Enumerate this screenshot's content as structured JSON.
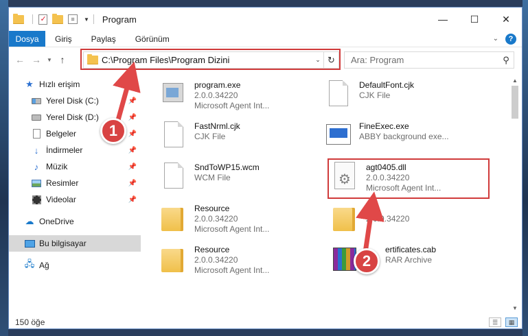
{
  "window": {
    "title": "Program",
    "controls": {
      "minimize": "—",
      "maximize": "☐",
      "close": "✕"
    }
  },
  "ribbon": {
    "tabs": [
      "Dosya",
      "Giriş",
      "Paylaş",
      "Görünüm"
    ],
    "help": "?"
  },
  "address_bar": {
    "path": "C:\\Program Files\\Program Dizini"
  },
  "search": {
    "placeholder": "Ara: Program"
  },
  "sidebar": {
    "items": [
      {
        "label": "Hızlı erişim",
        "icon": "star-icon",
        "pinned": false
      },
      {
        "label": "Yerel Disk (C:)",
        "icon": "drive-c-icon",
        "pinned": true
      },
      {
        "label": "Yerel Disk (D:)",
        "icon": "drive-icon",
        "pinned": true
      },
      {
        "label": "Belgeler",
        "icon": "document-icon",
        "pinned": true
      },
      {
        "label": "İndirmeler",
        "icon": "download-icon",
        "pinned": true
      },
      {
        "label": "Müzik",
        "icon": "music-icon",
        "pinned": true
      },
      {
        "label": "Resimler",
        "icon": "pictures-icon",
        "pinned": true
      },
      {
        "label": "Videolar",
        "icon": "videos-icon",
        "pinned": true
      },
      {
        "label": "OneDrive",
        "icon": "cloud-icon",
        "pinned": false
      },
      {
        "label": "Bu bilgisayar",
        "icon": "computer-icon",
        "pinned": false,
        "selected": true
      },
      {
        "label": "Ağ",
        "icon": "network-icon",
        "pinned": false
      }
    ]
  },
  "files": [
    {
      "name": "program.exe",
      "line2": "2.0.0.34220",
      "line3": "Microsoft Agent Int...",
      "icon": "exe-icon"
    },
    {
      "name": "DefaultFont.cjk",
      "line2": "CJK File",
      "line3": "",
      "icon": "blank-file-icon"
    },
    {
      "name": "FastNrml.cjk",
      "line2": "CJK File",
      "line3": "",
      "icon": "blank-file-icon"
    },
    {
      "name": "FineExec.exe",
      "line2": "ABBY background exe...",
      "line3": "",
      "icon": "app-window-icon"
    },
    {
      "name": "SndToWP15.wcm",
      "line2": "WCM File",
      "line3": "",
      "icon": "blank-file-icon"
    },
    {
      "name": "agt0405.dll",
      "line2": "2.0.0.34220",
      "line3": "Microsoft Agent Int...",
      "icon": "dll-gear-icon"
    },
    {
      "name": "Resource",
      "line2": "2.0.0.34220",
      "line3": "Microsoft Agent Int...",
      "icon": "folder-icon"
    },
    {
      "name": "",
      "line2": "2.0.0.34220",
      "line3": "",
      "icon": "folder-icon"
    },
    {
      "name": "Resource",
      "line2": "2.0.0.34220",
      "line3": "Microsoft Agent Int...",
      "icon": "folder-icon"
    },
    {
      "name": "ertificates.cab",
      "line2": "RAR Archive",
      "line3": "",
      "icon": "rar-archive-icon"
    }
  ],
  "status": {
    "item_count": "150 öğe"
  },
  "callouts": [
    "1",
    "2"
  ],
  "colors": {
    "accent": "#1979ca",
    "highlight": "#d03a3a",
    "selected_bg": "#d8d8d8"
  }
}
